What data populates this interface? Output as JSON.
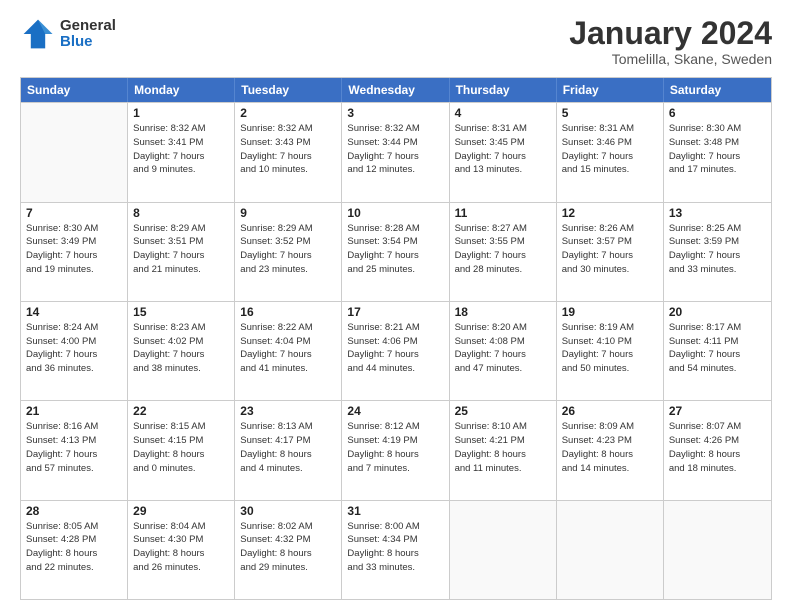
{
  "header": {
    "logo_general": "General",
    "logo_blue": "Blue",
    "month_title": "January 2024",
    "location": "Tomelilla, Skane, Sweden"
  },
  "days_of_week": [
    "Sunday",
    "Monday",
    "Tuesday",
    "Wednesday",
    "Thursday",
    "Friday",
    "Saturday"
  ],
  "weeks": [
    [
      {
        "day": "",
        "info": ""
      },
      {
        "day": "1",
        "info": "Sunrise: 8:32 AM\nSunset: 3:41 PM\nDaylight: 7 hours\nand 9 minutes."
      },
      {
        "day": "2",
        "info": "Sunrise: 8:32 AM\nSunset: 3:43 PM\nDaylight: 7 hours\nand 10 minutes."
      },
      {
        "day": "3",
        "info": "Sunrise: 8:32 AM\nSunset: 3:44 PM\nDaylight: 7 hours\nand 12 minutes."
      },
      {
        "day": "4",
        "info": "Sunrise: 8:31 AM\nSunset: 3:45 PM\nDaylight: 7 hours\nand 13 minutes."
      },
      {
        "day": "5",
        "info": "Sunrise: 8:31 AM\nSunset: 3:46 PM\nDaylight: 7 hours\nand 15 minutes."
      },
      {
        "day": "6",
        "info": "Sunrise: 8:30 AM\nSunset: 3:48 PM\nDaylight: 7 hours\nand 17 minutes."
      }
    ],
    [
      {
        "day": "7",
        "info": "Sunrise: 8:30 AM\nSunset: 3:49 PM\nDaylight: 7 hours\nand 19 minutes."
      },
      {
        "day": "8",
        "info": "Sunrise: 8:29 AM\nSunset: 3:51 PM\nDaylight: 7 hours\nand 21 minutes."
      },
      {
        "day": "9",
        "info": "Sunrise: 8:29 AM\nSunset: 3:52 PM\nDaylight: 7 hours\nand 23 minutes."
      },
      {
        "day": "10",
        "info": "Sunrise: 8:28 AM\nSunset: 3:54 PM\nDaylight: 7 hours\nand 25 minutes."
      },
      {
        "day": "11",
        "info": "Sunrise: 8:27 AM\nSunset: 3:55 PM\nDaylight: 7 hours\nand 28 minutes."
      },
      {
        "day": "12",
        "info": "Sunrise: 8:26 AM\nSunset: 3:57 PM\nDaylight: 7 hours\nand 30 minutes."
      },
      {
        "day": "13",
        "info": "Sunrise: 8:25 AM\nSunset: 3:59 PM\nDaylight: 7 hours\nand 33 minutes."
      }
    ],
    [
      {
        "day": "14",
        "info": "Sunrise: 8:24 AM\nSunset: 4:00 PM\nDaylight: 7 hours\nand 36 minutes."
      },
      {
        "day": "15",
        "info": "Sunrise: 8:23 AM\nSunset: 4:02 PM\nDaylight: 7 hours\nand 38 minutes."
      },
      {
        "day": "16",
        "info": "Sunrise: 8:22 AM\nSunset: 4:04 PM\nDaylight: 7 hours\nand 41 minutes."
      },
      {
        "day": "17",
        "info": "Sunrise: 8:21 AM\nSunset: 4:06 PM\nDaylight: 7 hours\nand 44 minutes."
      },
      {
        "day": "18",
        "info": "Sunrise: 8:20 AM\nSunset: 4:08 PM\nDaylight: 7 hours\nand 47 minutes."
      },
      {
        "day": "19",
        "info": "Sunrise: 8:19 AM\nSunset: 4:10 PM\nDaylight: 7 hours\nand 50 minutes."
      },
      {
        "day": "20",
        "info": "Sunrise: 8:17 AM\nSunset: 4:11 PM\nDaylight: 7 hours\nand 54 minutes."
      }
    ],
    [
      {
        "day": "21",
        "info": "Sunrise: 8:16 AM\nSunset: 4:13 PM\nDaylight: 7 hours\nand 57 minutes."
      },
      {
        "day": "22",
        "info": "Sunrise: 8:15 AM\nSunset: 4:15 PM\nDaylight: 8 hours\nand 0 minutes."
      },
      {
        "day": "23",
        "info": "Sunrise: 8:13 AM\nSunset: 4:17 PM\nDaylight: 8 hours\nand 4 minutes."
      },
      {
        "day": "24",
        "info": "Sunrise: 8:12 AM\nSunset: 4:19 PM\nDaylight: 8 hours\nand 7 minutes."
      },
      {
        "day": "25",
        "info": "Sunrise: 8:10 AM\nSunset: 4:21 PM\nDaylight: 8 hours\nand 11 minutes."
      },
      {
        "day": "26",
        "info": "Sunrise: 8:09 AM\nSunset: 4:23 PM\nDaylight: 8 hours\nand 14 minutes."
      },
      {
        "day": "27",
        "info": "Sunrise: 8:07 AM\nSunset: 4:26 PM\nDaylight: 8 hours\nand 18 minutes."
      }
    ],
    [
      {
        "day": "28",
        "info": "Sunrise: 8:05 AM\nSunset: 4:28 PM\nDaylight: 8 hours\nand 22 minutes."
      },
      {
        "day": "29",
        "info": "Sunrise: 8:04 AM\nSunset: 4:30 PM\nDaylight: 8 hours\nand 26 minutes."
      },
      {
        "day": "30",
        "info": "Sunrise: 8:02 AM\nSunset: 4:32 PM\nDaylight: 8 hours\nand 29 minutes."
      },
      {
        "day": "31",
        "info": "Sunrise: 8:00 AM\nSunset: 4:34 PM\nDaylight: 8 hours\nand 33 minutes."
      },
      {
        "day": "",
        "info": ""
      },
      {
        "day": "",
        "info": ""
      },
      {
        "day": "",
        "info": ""
      }
    ]
  ]
}
